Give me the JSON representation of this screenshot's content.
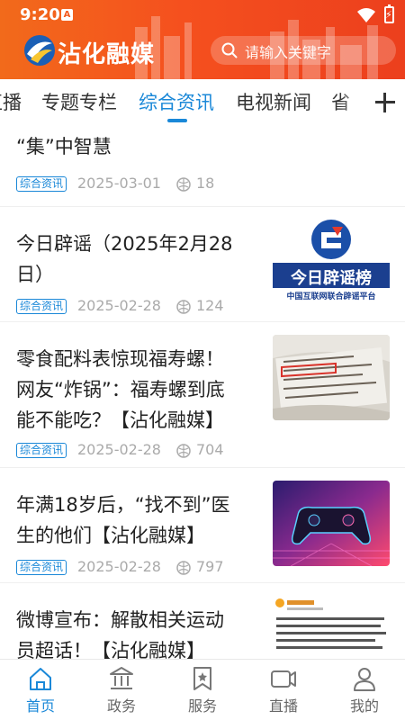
{
  "status_bar": {
    "time": "9:20",
    "notification_glyph": "A"
  },
  "header": {
    "app_title": "沾化融媒",
    "search_placeholder": "请输入关键字",
    "accent_color": "#f35a1f"
  },
  "tabs": {
    "items": [
      {
        "label": "直播"
      },
      {
        "label": "专题专栏"
      },
      {
        "label": "综合资讯",
        "active": true
      },
      {
        "label": "电视新闻"
      },
      {
        "label": "省"
      }
    ],
    "active_color": "#1a88d8"
  },
  "news": {
    "items": [
      {
        "title_lines": [
          "“集”中智慧"
        ],
        "tag": "综合资讯",
        "date": "2025-03-01",
        "views": "18"
      },
      {
        "title_lines": [
          "今日辟谣（2025年2月28",
          "日）"
        ],
        "tag": "综合资讯",
        "date": "2025-02-28",
        "views": "124",
        "thumb": {
          "banner": "今日辟谣榜",
          "subtitle": "中国互联网联合辟谣平台"
        }
      },
      {
        "title_lines": [
          "零食配料表惊现福寿螺！",
          "网友“炸锅”：福寿螺到底",
          "能不能吃？【沾化融媒】"
        ],
        "tag": "综合资讯",
        "date": "2025-02-28",
        "views": "704"
      },
      {
        "title_lines": [
          "年满18岁后，“找不到”医",
          "生的他们【沾化融媒】"
        ],
        "tag": "综合资讯",
        "date": "2025-02-28",
        "views": "797"
      },
      {
        "title_lines": [
          "微博宣布：解散相关运动",
          "员超话！【沾化融媒】"
        ]
      }
    ]
  },
  "bottom_nav": [
    {
      "label": "首页",
      "icon": "home-icon",
      "active": true
    },
    {
      "label": "政务",
      "icon": "government-icon"
    },
    {
      "label": "服务",
      "icon": "service-bookmark-icon"
    },
    {
      "label": "直播",
      "icon": "video-camera-icon"
    },
    {
      "label": "我的",
      "icon": "user-icon"
    }
  ]
}
